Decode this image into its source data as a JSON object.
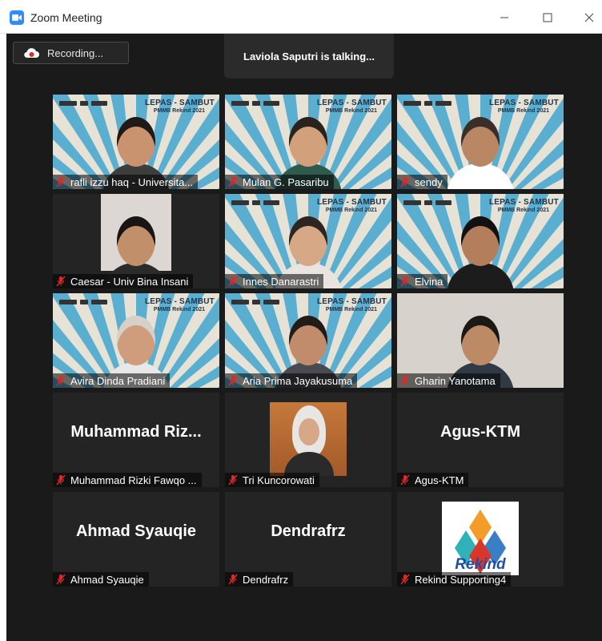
{
  "window": {
    "title": "Zoom Meeting"
  },
  "toolbar": {
    "recording_label": "Recording..."
  },
  "speaker": {
    "status": "Laviola Saputri is talking..."
  },
  "colors": {
    "accent": "#2d8cff",
    "mute": "#e02828",
    "background": "#1a1a1a",
    "tile": "#242424",
    "highlight": "#c7c33a"
  },
  "vbg": {
    "title": "LEPAS - SAMBUT",
    "subtitle": "PMMB Rekind 2021"
  },
  "participants": [
    {
      "name": "rafli izzu haq - Universita...",
      "muted": true,
      "video": true,
      "vbg": true
    },
    {
      "name": "Mulan G. Pasaribu",
      "muted": true,
      "video": true,
      "vbg": true
    },
    {
      "name": "sendy",
      "muted": true,
      "video": true,
      "vbg": true
    },
    {
      "name": "Caesar - Univ Bina Insani",
      "muted": true,
      "video": true,
      "vbg": false
    },
    {
      "name": "Innes Danarastri",
      "muted": true,
      "video": true,
      "vbg": true
    },
    {
      "name": "Elvina",
      "muted": true,
      "video": true,
      "vbg": true
    },
    {
      "name": "Avira Dinda Pradiani",
      "muted": true,
      "video": true,
      "vbg": true
    },
    {
      "name": "Aria Prima Jayakusuma",
      "muted": true,
      "video": true,
      "vbg": true
    },
    {
      "name": "Gharin Yanotama",
      "muted": true,
      "video": true,
      "vbg": false
    },
    {
      "name": "Muhammad Rizki Fawqo ...",
      "display": "Muhammad  Riz...",
      "muted": true,
      "video": false
    },
    {
      "name": "Tri Kuncorowati",
      "muted": true,
      "video": false,
      "photo": true
    },
    {
      "name": "Agus-KTM",
      "display": "Agus-KTM",
      "muted": true,
      "video": false
    },
    {
      "name": "Ahmad Syauqie",
      "display": "Ahmad Syauqie",
      "muted": true,
      "video": false
    },
    {
      "name": "Dendrafrz",
      "display": "Dendrafrz",
      "muted": true,
      "video": false
    },
    {
      "name": "Rekind Supporting4",
      "muted": true,
      "video": false,
      "logo": "Rekind"
    }
  ]
}
